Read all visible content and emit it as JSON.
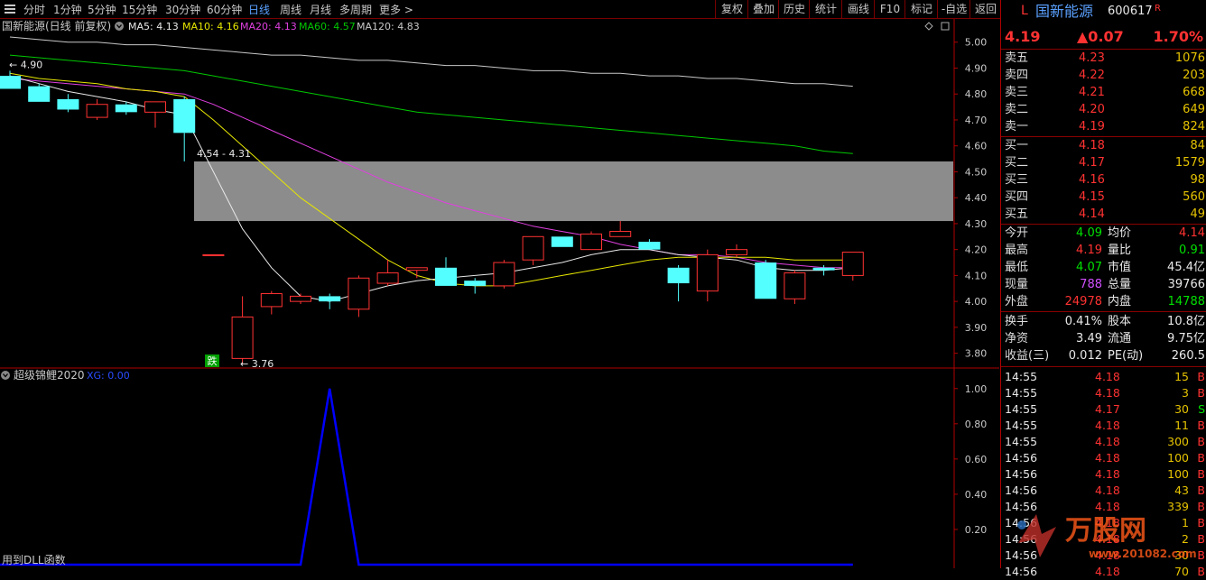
{
  "toolbar": {
    "timeframes": [
      "分时",
      "1分钟",
      "5分钟",
      "15分钟",
      "30分钟",
      "60分钟",
      "日线",
      "周线",
      "月线",
      "多周期",
      "更多 >"
    ],
    "active_timeframe": "日线",
    "buttons": [
      "复权",
      "叠加",
      "历史",
      "统计",
      "画线",
      "F10",
      "标记",
      "-自选",
      "返回"
    ]
  },
  "chart_header": {
    "title": "国新能源(日线 前复权)",
    "ma5": "MA5: 4.13",
    "ma10": "MA10: 4.16",
    "ma20": "MA20: 4.13",
    "ma60": "MA60: 4.57",
    "ma120": "MA120: 4.83"
  },
  "annotations": {
    "high_label": "4.90",
    "low_label": "3.76",
    "zone_label": "4.54 - 4.31",
    "fall_badge": "跌"
  },
  "indicator": {
    "title": "超级锦鲤2020",
    "xg_label": "XG: 0.00",
    "footer": "用到DLL函数"
  },
  "colors": {
    "up": "#ff3232",
    "down": "#54ffff",
    "ma5": "#e8e8e8",
    "ma10": "#e6e600",
    "ma20": "#e040e0",
    "ma60": "#00c800",
    "ma120": "#c8c8c8",
    "zone": "#8c8c8c",
    "signal": "#0000ff"
  },
  "chart_data": {
    "type": "candlestick",
    "price_axis": {
      "ticks": [
        "5.00",
        "4.90",
        "4.80",
        "4.70",
        "4.60",
        "4.50",
        "4.40",
        "4.30",
        "4.20",
        "4.10",
        "4.00",
        "3.90",
        "3.80"
      ],
      "ylim": [
        3.75,
        5.02
      ]
    },
    "candles": [
      {
        "o": 4.87,
        "h": 4.89,
        "l": 4.82,
        "c": 4.82
      },
      {
        "o": 4.83,
        "h": 4.84,
        "l": 4.77,
        "c": 4.77
      },
      {
        "o": 4.78,
        "h": 4.8,
        "l": 4.73,
        "c": 4.74
      },
      {
        "o": 4.71,
        "h": 4.78,
        "l": 4.7,
        "c": 4.76
      },
      {
        "o": 4.76,
        "h": 4.77,
        "l": 4.72,
        "c": 4.73
      },
      {
        "o": 4.73,
        "h": 4.77,
        "l": 4.67,
        "c": 4.77
      },
      {
        "o": 4.78,
        "h": 4.79,
        "l": 4.54,
        "c": 4.65
      },
      {
        "o": 4.18,
        "h": 4.18,
        "l": 4.18,
        "c": 4.18
      },
      {
        "o": 3.78,
        "h": 4.02,
        "l": 3.76,
        "c": 3.94
      },
      {
        "o": 3.98,
        "h": 4.04,
        "l": 3.95,
        "c": 4.03
      },
      {
        "o": 4.0,
        "h": 4.03,
        "l": 3.99,
        "c": 4.02
      },
      {
        "o": 4.02,
        "h": 4.03,
        "l": 3.97,
        "c": 4.0
      },
      {
        "o": 3.97,
        "h": 4.1,
        "l": 3.94,
        "c": 4.09
      },
      {
        "o": 4.07,
        "h": 4.16,
        "l": 4.06,
        "c": 4.11
      },
      {
        "o": 4.12,
        "h": 4.13,
        "l": 4.09,
        "c": 4.13
      },
      {
        "o": 4.13,
        "h": 4.17,
        "l": 4.06,
        "c": 4.06
      },
      {
        "o": 4.08,
        "h": 4.09,
        "l": 4.03,
        "c": 4.06
      },
      {
        "o": 4.06,
        "h": 4.16,
        "l": 4.05,
        "c": 4.15
      },
      {
        "o": 4.16,
        "h": 4.25,
        "l": 4.14,
        "c": 4.25
      },
      {
        "o": 4.25,
        "h": 4.25,
        "l": 4.21,
        "c": 4.21
      },
      {
        "o": 4.2,
        "h": 4.27,
        "l": 4.2,
        "c": 4.26
      },
      {
        "o": 4.25,
        "h": 4.31,
        "l": 4.25,
        "c": 4.27
      },
      {
        "o": 4.23,
        "h": 4.24,
        "l": 4.2,
        "c": 4.2
      },
      {
        "o": 4.13,
        "h": 4.14,
        "l": 4.0,
        "c": 4.07
      },
      {
        "o": 4.04,
        "h": 4.2,
        "l": 4.0,
        "c": 4.18
      },
      {
        "o": 4.18,
        "h": 4.22,
        "l": 4.17,
        "c": 4.2
      },
      {
        "o": 4.15,
        "h": 4.16,
        "l": 4.01,
        "c": 4.01
      },
      {
        "o": 4.01,
        "h": 4.12,
        "l": 3.99,
        "c": 4.11
      },
      {
        "o": 4.13,
        "h": 4.14,
        "l": 4.1,
        "c": 4.12
      },
      {
        "o": 4.1,
        "h": 4.19,
        "l": 4.08,
        "c": 4.19
      }
    ],
    "ma5": [
      4.87,
      4.84,
      4.81,
      4.79,
      4.77,
      4.74,
      4.72,
      4.5,
      4.28,
      4.13,
      4.02,
      4.0,
      4.03,
      4.06,
      4.08,
      4.09,
      4.1,
      4.11,
      4.13,
      4.15,
      4.18,
      4.2,
      4.2,
      4.18,
      4.17,
      4.16,
      4.13,
      4.12,
      4.12,
      4.13
    ],
    "ma10": [
      4.88,
      4.86,
      4.85,
      4.84,
      4.82,
      4.81,
      4.79,
      4.7,
      4.6,
      4.5,
      4.4,
      4.32,
      4.24,
      4.16,
      4.1,
      4.07,
      4.06,
      4.06,
      4.08,
      4.1,
      4.12,
      4.14,
      4.16,
      4.17,
      4.17,
      4.17,
      4.17,
      4.16,
      4.16,
      4.16
    ],
    "ma20": [
      4.86,
      4.85,
      4.84,
      4.83,
      4.82,
      4.81,
      4.8,
      4.76,
      4.71,
      4.66,
      4.61,
      4.56,
      4.51,
      4.46,
      4.42,
      4.38,
      4.35,
      4.32,
      4.29,
      4.27,
      4.25,
      4.22,
      4.2,
      4.18,
      4.18,
      4.17,
      4.15,
      4.14,
      4.13,
      4.13
    ],
    "ma60": [
      4.95,
      4.94,
      4.93,
      4.92,
      4.91,
      4.9,
      4.89,
      4.87,
      4.85,
      4.83,
      4.81,
      4.79,
      4.77,
      4.75,
      4.73,
      4.72,
      4.71,
      4.7,
      4.69,
      4.68,
      4.67,
      4.66,
      4.65,
      4.64,
      4.63,
      4.62,
      4.61,
      4.6,
      4.58,
      4.57
    ],
    "ma120": [
      5.02,
      5.01,
      5.0,
      5.0,
      4.99,
      4.99,
      4.98,
      4.97,
      4.96,
      4.95,
      4.95,
      4.94,
      4.93,
      4.93,
      4.92,
      4.91,
      4.91,
      4.9,
      4.89,
      4.89,
      4.88,
      4.88,
      4.87,
      4.87,
      4.86,
      4.86,
      4.85,
      4.84,
      4.84,
      4.83
    ],
    "zone": [
      4.31,
      4.54
    ],
    "indicator_axis": {
      "ticks": [
        "1.00",
        "0.80",
        "0.60",
        "0.40",
        "0.20"
      ],
      "ylim": [
        0,
        1.05
      ]
    },
    "indicator_values": [
      0,
      0,
      0,
      0,
      0,
      0,
      0,
      0,
      0,
      0,
      0,
      1,
      0,
      0,
      0,
      0,
      0,
      0,
      0,
      0,
      0,
      0,
      0,
      0,
      0,
      0,
      0,
      0,
      0,
      0
    ]
  },
  "quote": {
    "market_flag": "L",
    "name": "国新能源",
    "code": "600617",
    "r_mark": "R",
    "price": "4.19",
    "change": "▲0.07",
    "pct": "1.70%",
    "asks": [
      {
        "label": "卖五",
        "price": "4.23",
        "vol": "1076"
      },
      {
        "label": "卖四",
        "price": "4.22",
        "vol": "203"
      },
      {
        "label": "卖三",
        "price": "4.21",
        "vol": "668"
      },
      {
        "label": "卖二",
        "price": "4.20",
        "vol": "649"
      },
      {
        "label": "卖一",
        "price": "4.19",
        "vol": "824"
      }
    ],
    "bids": [
      {
        "label": "买一",
        "price": "4.18",
        "vol": "84"
      },
      {
        "label": "买二",
        "price": "4.17",
        "vol": "1579"
      },
      {
        "label": "买三",
        "price": "4.16",
        "vol": "98"
      },
      {
        "label": "买四",
        "price": "4.15",
        "vol": "560"
      },
      {
        "label": "买五",
        "price": "4.14",
        "vol": "49"
      }
    ],
    "stats": [
      {
        "l1": "今开",
        "v1": "4.09",
        "c1": "green",
        "l2": "均价",
        "v2": "4.14",
        "c2": "red"
      },
      {
        "l1": "最高",
        "v1": "4.19",
        "c1": "red",
        "l2": "量比",
        "v2": "0.91",
        "c2": "green"
      },
      {
        "l1": "最低",
        "v1": "4.07",
        "c1": "green",
        "l2": "市值",
        "v2": "45.4亿",
        "c2": "white"
      },
      {
        "l1": "现量",
        "v1": "788",
        "c1": "purple",
        "l2": "总量",
        "v2": "39766",
        "c2": "white"
      },
      {
        "l1": "外盘",
        "v1": "24978",
        "c1": "red",
        "l2": "内盘",
        "v2": "14788",
        "c2": "green"
      }
    ],
    "fundamentals": [
      {
        "l1": "换手",
        "v1": "0.41%",
        "l2": "股本",
        "v2": "10.8亿"
      },
      {
        "l1": "净资",
        "v1": "3.49",
        "l2": "流通",
        "v2": "9.75亿"
      },
      {
        "l1": "收益(三)",
        "v1": "0.012",
        "l2": "PE(动)",
        "v2": "260.5"
      }
    ],
    "ticks": [
      {
        "t": "14:55",
        "p": "4.18",
        "v": "15",
        "s": "B"
      },
      {
        "t": "14:55",
        "p": "4.18",
        "v": "3",
        "s": "B"
      },
      {
        "t": "14:55",
        "p": "4.17",
        "v": "30",
        "s": "S"
      },
      {
        "t": "14:55",
        "p": "4.18",
        "v": "11",
        "s": "B"
      },
      {
        "t": "14:55",
        "p": "4.18",
        "v": "300",
        "s": "B"
      },
      {
        "t": "14:56",
        "p": "4.18",
        "v": "100",
        "s": "B"
      },
      {
        "t": "14:56",
        "p": "4.18",
        "v": "100",
        "s": "B"
      },
      {
        "t": "14:56",
        "p": "4.18",
        "v": "43",
        "s": "B"
      },
      {
        "t": "14:56",
        "p": "4.18",
        "v": "339",
        "s": "B"
      },
      {
        "t": "14:56",
        "p": "4.18",
        "v": "1",
        "s": "B"
      },
      {
        "t": "14:56",
        "p": "4.18",
        "v": "2",
        "s": "B"
      },
      {
        "t": "14:56",
        "p": "4.18",
        "v": "30",
        "s": "B"
      },
      {
        "t": "14:56",
        "p": "4.18",
        "v": "70",
        "s": "B"
      }
    ]
  },
  "watermark": {
    "brand": "万股网",
    "url": "www.201082.com"
  }
}
